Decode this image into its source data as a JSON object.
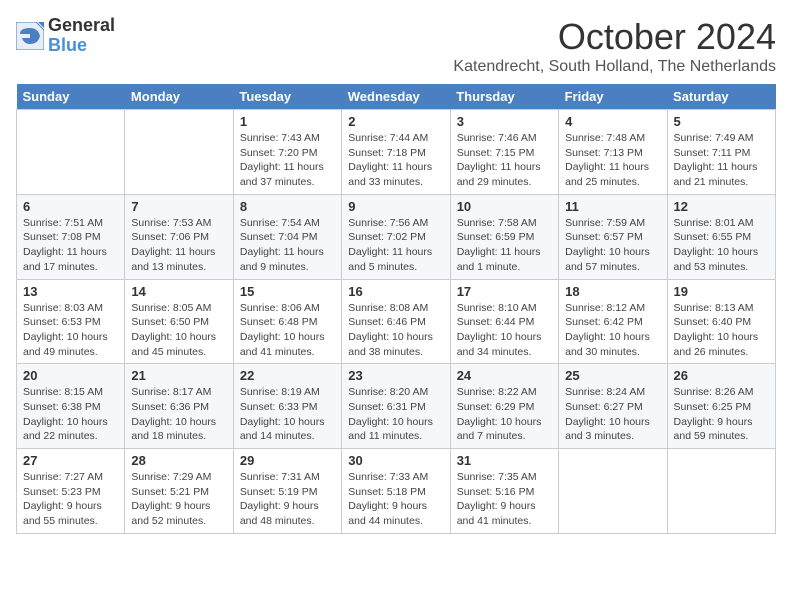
{
  "header": {
    "logo_general": "General",
    "logo_blue": "Blue",
    "month_title": "October 2024",
    "location": "Katendrecht, South Holland, The Netherlands"
  },
  "days_of_week": [
    "Sunday",
    "Monday",
    "Tuesday",
    "Wednesday",
    "Thursday",
    "Friday",
    "Saturday"
  ],
  "weeks": [
    [
      {
        "day": "",
        "info": ""
      },
      {
        "day": "",
        "info": ""
      },
      {
        "day": "1",
        "info": "Sunrise: 7:43 AM\nSunset: 7:20 PM\nDaylight: 11 hours and 37 minutes."
      },
      {
        "day": "2",
        "info": "Sunrise: 7:44 AM\nSunset: 7:18 PM\nDaylight: 11 hours and 33 minutes."
      },
      {
        "day": "3",
        "info": "Sunrise: 7:46 AM\nSunset: 7:15 PM\nDaylight: 11 hours and 29 minutes."
      },
      {
        "day": "4",
        "info": "Sunrise: 7:48 AM\nSunset: 7:13 PM\nDaylight: 11 hours and 25 minutes."
      },
      {
        "day": "5",
        "info": "Sunrise: 7:49 AM\nSunset: 7:11 PM\nDaylight: 11 hours and 21 minutes."
      }
    ],
    [
      {
        "day": "6",
        "info": "Sunrise: 7:51 AM\nSunset: 7:08 PM\nDaylight: 11 hours and 17 minutes."
      },
      {
        "day": "7",
        "info": "Sunrise: 7:53 AM\nSunset: 7:06 PM\nDaylight: 11 hours and 13 minutes."
      },
      {
        "day": "8",
        "info": "Sunrise: 7:54 AM\nSunset: 7:04 PM\nDaylight: 11 hours and 9 minutes."
      },
      {
        "day": "9",
        "info": "Sunrise: 7:56 AM\nSunset: 7:02 PM\nDaylight: 11 hours and 5 minutes."
      },
      {
        "day": "10",
        "info": "Sunrise: 7:58 AM\nSunset: 6:59 PM\nDaylight: 11 hours and 1 minute."
      },
      {
        "day": "11",
        "info": "Sunrise: 7:59 AM\nSunset: 6:57 PM\nDaylight: 10 hours and 57 minutes."
      },
      {
        "day": "12",
        "info": "Sunrise: 8:01 AM\nSunset: 6:55 PM\nDaylight: 10 hours and 53 minutes."
      }
    ],
    [
      {
        "day": "13",
        "info": "Sunrise: 8:03 AM\nSunset: 6:53 PM\nDaylight: 10 hours and 49 minutes."
      },
      {
        "day": "14",
        "info": "Sunrise: 8:05 AM\nSunset: 6:50 PM\nDaylight: 10 hours and 45 minutes."
      },
      {
        "day": "15",
        "info": "Sunrise: 8:06 AM\nSunset: 6:48 PM\nDaylight: 10 hours and 41 minutes."
      },
      {
        "day": "16",
        "info": "Sunrise: 8:08 AM\nSunset: 6:46 PM\nDaylight: 10 hours and 38 minutes."
      },
      {
        "day": "17",
        "info": "Sunrise: 8:10 AM\nSunset: 6:44 PM\nDaylight: 10 hours and 34 minutes."
      },
      {
        "day": "18",
        "info": "Sunrise: 8:12 AM\nSunset: 6:42 PM\nDaylight: 10 hours and 30 minutes."
      },
      {
        "day": "19",
        "info": "Sunrise: 8:13 AM\nSunset: 6:40 PM\nDaylight: 10 hours and 26 minutes."
      }
    ],
    [
      {
        "day": "20",
        "info": "Sunrise: 8:15 AM\nSunset: 6:38 PM\nDaylight: 10 hours and 22 minutes."
      },
      {
        "day": "21",
        "info": "Sunrise: 8:17 AM\nSunset: 6:36 PM\nDaylight: 10 hours and 18 minutes."
      },
      {
        "day": "22",
        "info": "Sunrise: 8:19 AM\nSunset: 6:33 PM\nDaylight: 10 hours and 14 minutes."
      },
      {
        "day": "23",
        "info": "Sunrise: 8:20 AM\nSunset: 6:31 PM\nDaylight: 10 hours and 11 minutes."
      },
      {
        "day": "24",
        "info": "Sunrise: 8:22 AM\nSunset: 6:29 PM\nDaylight: 10 hours and 7 minutes."
      },
      {
        "day": "25",
        "info": "Sunrise: 8:24 AM\nSunset: 6:27 PM\nDaylight: 10 hours and 3 minutes."
      },
      {
        "day": "26",
        "info": "Sunrise: 8:26 AM\nSunset: 6:25 PM\nDaylight: 9 hours and 59 minutes."
      }
    ],
    [
      {
        "day": "27",
        "info": "Sunrise: 7:27 AM\nSunset: 5:23 PM\nDaylight: 9 hours and 55 minutes."
      },
      {
        "day": "28",
        "info": "Sunrise: 7:29 AM\nSunset: 5:21 PM\nDaylight: 9 hours and 52 minutes."
      },
      {
        "day": "29",
        "info": "Sunrise: 7:31 AM\nSunset: 5:19 PM\nDaylight: 9 hours and 48 minutes."
      },
      {
        "day": "30",
        "info": "Sunrise: 7:33 AM\nSunset: 5:18 PM\nDaylight: 9 hours and 44 minutes."
      },
      {
        "day": "31",
        "info": "Sunrise: 7:35 AM\nSunset: 5:16 PM\nDaylight: 9 hours and 41 minutes."
      },
      {
        "day": "",
        "info": ""
      },
      {
        "day": "",
        "info": ""
      }
    ]
  ]
}
